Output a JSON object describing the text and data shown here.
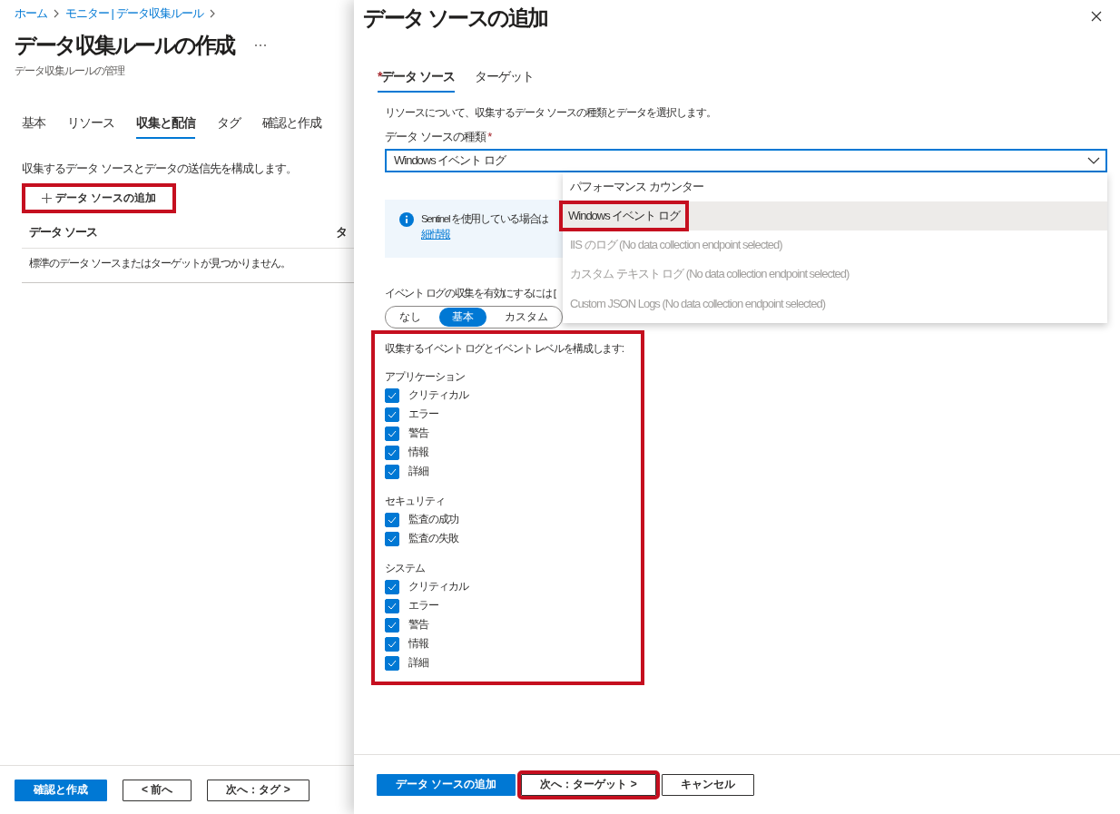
{
  "breadcrumb": [
    {
      "label": "ホーム"
    },
    {
      "label": "モニター | データ収集ルール"
    }
  ],
  "page": {
    "title": "データ収集ルールの作成",
    "subtitle": "データ収集ルールの管理"
  },
  "tabs": [
    {
      "label": "基本",
      "selected": false
    },
    {
      "label": "リソース",
      "selected": false
    },
    {
      "label": "収集と配信",
      "selected": true
    },
    {
      "label": "タグ",
      "selected": false
    },
    {
      "label": "確認と作成",
      "selected": false
    }
  ],
  "description": "収集するデータ ソースとデータの送信先を構成します。",
  "add_button": {
    "label": "データ ソースの追加",
    "highlighted": true
  },
  "table": {
    "columns": [
      "データ ソース",
      "タ"
    ],
    "empty_message": "標準のデータ ソースまたはターゲットが見つかりません。"
  },
  "footer_buttons": [
    {
      "label": "確認と作成",
      "kind": "primary",
      "highlighted": false
    },
    {
      "label": "< 前へ",
      "kind": "secondary",
      "highlighted": false
    },
    {
      "label": "次へ：タグ >",
      "kind": "secondary",
      "highlighted": false
    }
  ],
  "panel": {
    "title": "データ ソースの追加",
    "tabs": [
      {
        "label": "データ ソース",
        "marker": "*",
        "selected": true
      },
      {
        "label": "ターゲット",
        "selected": false
      }
    ],
    "description": "リソースについて、収集するデータ ソースの種類とデータを選択します。",
    "field": {
      "label": "データ ソースの種類",
      "marker": "*",
      "value": "Windows イベント ログ"
    },
    "dropdown": {
      "options": [
        {
          "label": "パフォーマンス カウンター",
          "disabled": false,
          "selected": false,
          "highlighted": false
        },
        {
          "label": "Windows イベント ログ",
          "disabled": false,
          "selected": true,
          "highlighted": true
        },
        {
          "label": "IIS のログ (No data collection endpoint selected)",
          "disabled": true,
          "selected": false,
          "highlighted": false
        },
        {
          "label": "カスタム テキスト ログ (No data collection endpoint selected)",
          "disabled": true,
          "selected": false,
          "highlighted": false
        },
        {
          "label": "Custom JSON Logs (No data collection endpoint selected)",
          "disabled": true,
          "selected": false,
          "highlighted": false
        }
      ]
    },
    "info": {
      "text": "Sentinel を使用している場合は",
      "link": "細情報"
    },
    "enable_text": "イベント ログの収集を有効にするには [",
    "mode_options": [
      {
        "label": "なし",
        "selected": false
      },
      {
        "label": "基本",
        "selected": true
      },
      {
        "label": "カスタム",
        "selected": false
      }
    ],
    "event_config": {
      "highlighted": true,
      "heading": "収集するイベント ログとイベント レベルを構成します:",
      "groups": [
        {
          "name": "アプリケーション",
          "levels": [
            {
              "label": "クリティカル",
              "checked": true
            },
            {
              "label": "エラー",
              "checked": true
            },
            {
              "label": "警告",
              "checked": true
            },
            {
              "label": "情報",
              "checked": true
            },
            {
              "label": "詳細",
              "checked": true
            }
          ]
        },
        {
          "name": "セキュリティ",
          "levels": [
            {
              "label": "監査の成功",
              "checked": true
            },
            {
              "label": "監査の失敗",
              "checked": true
            }
          ]
        },
        {
          "name": "システム",
          "levels": [
            {
              "label": "クリティカル",
              "checked": true
            },
            {
              "label": "エラー",
              "checked": true
            },
            {
              "label": "警告",
              "checked": true
            },
            {
              "label": "情報",
              "checked": true
            },
            {
              "label": "詳細",
              "checked": true
            }
          ]
        }
      ]
    },
    "footer_buttons": [
      {
        "label": "データ ソースの追加",
        "kind": "primary",
        "highlighted": false
      },
      {
        "label": "次へ：ターゲット >",
        "kind": "secondary",
        "highlighted": true
      },
      {
        "label": "キャンセル",
        "kind": "secondary",
        "highlighted": false
      }
    ]
  }
}
